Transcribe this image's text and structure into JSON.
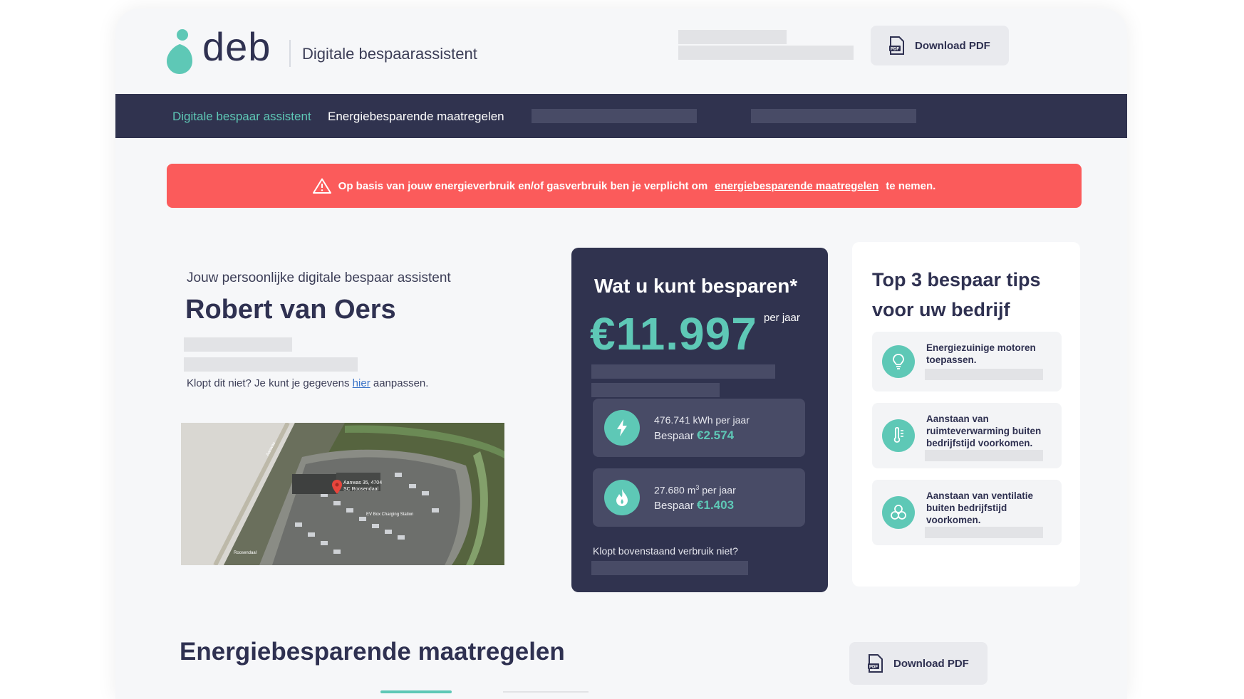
{
  "header": {
    "logo_text": "deb",
    "tagline": "Digitale bespaarassistent",
    "download_label": "Download PDF",
    "pdf_icon_label": "PDF"
  },
  "nav": {
    "items": [
      {
        "label": "Digitale bespaar assistent",
        "active": true
      },
      {
        "label": "Energiebesparende maatregelen",
        "active": false
      }
    ]
  },
  "alert": {
    "text_before": "Op basis van jouw energieverbruik en/of gasverbruik ben je verplicht om",
    "link": "energiebesparende maatregelen",
    "text_after": "te nemen.",
    "icon": "warning-icon"
  },
  "profile": {
    "intro": "Jouw persoonlijke digitale bespaar assistent",
    "name": "Robert van Oers",
    "note_before": "Klopt dit niet? Je kunt je gegevens",
    "note_link": "hier",
    "note_after": "aanpassen."
  },
  "map": {
    "pin_label_1": "Aanwas 35, 4704",
    "pin_label_2": "SC Roosendaal",
    "poi_1": "EV Box Charging Station",
    "poi_2": "Aanwas",
    "poi_3": "Roosendaal"
  },
  "savings": {
    "title": "Wat u kunt besparen*",
    "amount": "€11.997",
    "per": "per jaar",
    "electricity": {
      "usage": "476.741 kWh per jaar",
      "save_label": "Bespaar",
      "save_value": "€2.574",
      "icon": "lightning-icon"
    },
    "gas": {
      "usage_value": "27.680 m",
      "usage_sup": "3",
      "usage_unit": " per jaar",
      "save_label": "Bespaar",
      "save_value": "€1.403",
      "icon": "flame-icon"
    },
    "footer": "Klopt bovenstaand verbruik niet?"
  },
  "tips": {
    "title": "Top 3 bespaar tips voor uw bedrijf",
    "items": [
      {
        "text": "Energiezuinige motoren toepassen.",
        "icon": "lightbulb-icon"
      },
      {
        "text": "Aanstaan van ruimteverwarming buiten bedrijfstijd voorkomen.",
        "icon": "thermometer-icon"
      },
      {
        "text": "Aanstaan van ventilatie buiten bedrijfstijd voorkomen.",
        "icon": "fan-icon"
      }
    ]
  },
  "section": {
    "title": "Energiebesparende maatregelen",
    "download_label": "Download PDF"
  },
  "colors": {
    "navy": "#30334f",
    "teal": "#5ec8b6",
    "alert_red": "#fb5b5b"
  }
}
